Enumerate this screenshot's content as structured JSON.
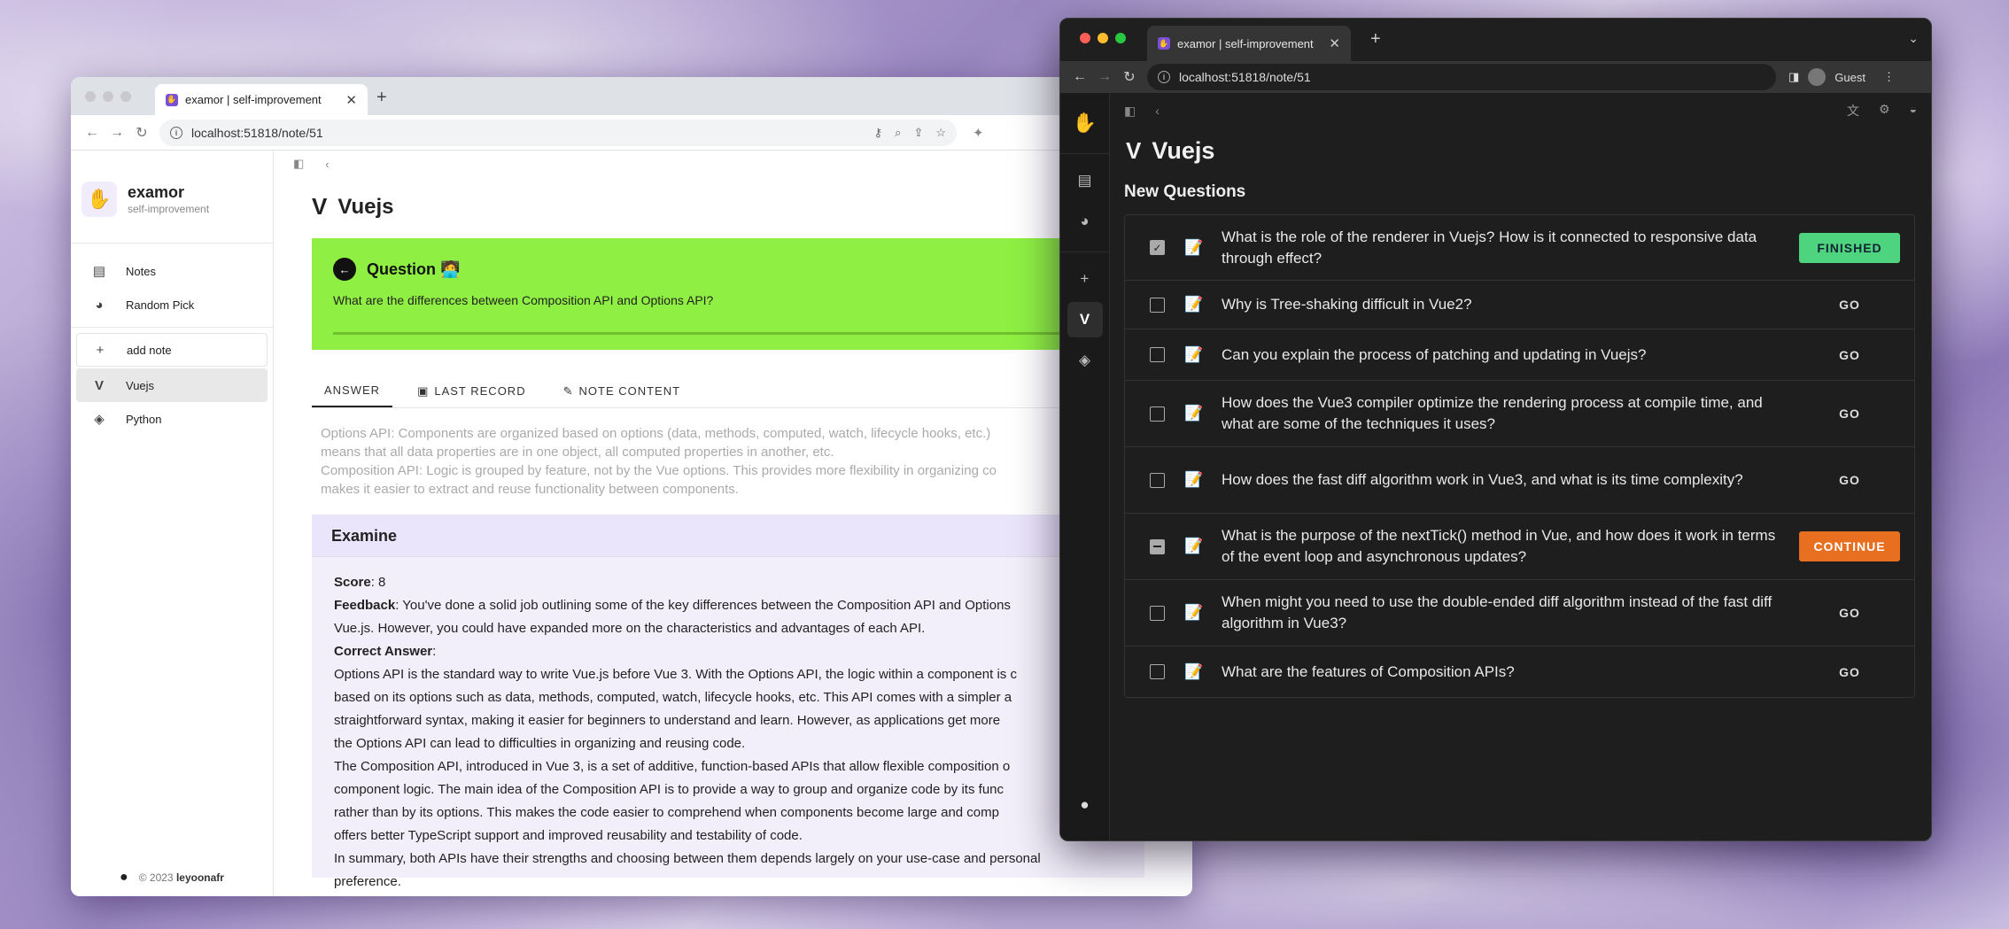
{
  "left": {
    "tab_title": "examor | self-improvement",
    "url": "localhost:51818/note/51",
    "brand": {
      "name": "examor",
      "subtitle": "self-improvement"
    },
    "nav": [
      {
        "label": "Notes",
        "icon": "notes-icon"
      },
      {
        "label": "Random Pick",
        "icon": "brain-icon"
      }
    ],
    "add_note": "add note",
    "notes": [
      {
        "label": "Vuejs",
        "icon": "vue-icon"
      },
      {
        "label": "Python",
        "icon": "python-icon"
      }
    ],
    "footer": {
      "copy": "© 2023",
      "author": "leyoonafr"
    },
    "page_title": "Vuejs",
    "question": {
      "heading": "Question",
      "emoji": "🧑‍💻",
      "text": "What are the differences between Composition API and Options API?"
    },
    "tabs": [
      "ANSWER",
      "LAST RECORD",
      "NOTE CONTENT"
    ],
    "answer_lines": [
      "Options API: Components are organized based on options (data, methods, computed, watch, lifecycle hooks, etc.)",
      "means that all data properties are in one object, all computed properties in another, etc.",
      "Composition API: Logic is grouped by feature, not by the Vue options. This provides more flexibility in organizing co",
      "makes it easier to extract and reuse functionality between components."
    ],
    "examine": {
      "heading": "Examine",
      "score_label": "Score",
      "score": "8",
      "feedback_label": "Feedback",
      "feedback": "You've done a solid job outlining some of the key differences between the Composition API and Options",
      "feedback2": "Vue.js. However, you could have expanded more on the characteristics and advantages of each API.",
      "correct_label": "Correct Answer",
      "lines": [
        "Options API is the standard way to write Vue.js before Vue 3. With the Options API, the logic within a component is c",
        "based on its options such as data, methods, computed, watch, lifecycle hooks, etc. This API comes with a simpler a",
        "straightforward syntax, making it easier for beginners to understand and learn. However, as applications get more",
        "the Options API can lead to difficulties in organizing and reusing code.",
        "The Composition API, introduced in Vue 3, is a set of additive, function-based APIs that allow flexible composition o",
        "component logic. The main idea of the Composition API is to provide a way to group and organize code by its func",
        "rather than by its options. This makes the code easier to comprehend when components become large and comp",
        "offers better TypeScript support and improved reusability and testability of code.",
        "In summary, both APIs have their strengths and choosing between them depends largely on your use-case and personal",
        "preference."
      ]
    }
  },
  "right": {
    "tab_title": "examor | self-improvement",
    "url": "localhost:51818/note/51",
    "profile": "Guest",
    "page_title": "Vuejs",
    "section": "New Questions",
    "questions": [
      {
        "text": "What is the role of the renderer in Vuejs? How is it connected to responsive data through effect?",
        "action": "FINISHED",
        "state": "checked"
      },
      {
        "text": "Why is Tree-shaking difficult in Vue2?",
        "action": "GO",
        "state": "empty"
      },
      {
        "text": "Can you explain the process of patching and updating in Vuejs?",
        "action": "GO",
        "state": "empty"
      },
      {
        "text": "How does the Vue3 compiler optimize the rendering process at compile time, and what are some of the techniques it uses?",
        "action": "GO",
        "state": "empty"
      },
      {
        "text": "How does the fast diff algorithm work in Vue3, and what is its time complexity?",
        "action": "GO",
        "state": "empty"
      },
      {
        "text": "What is the purpose of the nextTick() method in Vue, and how does it work in terms of the event loop and asynchronous updates?",
        "action": "CONTINUE",
        "state": "indeterminate"
      },
      {
        "text": "When might you need to use the double-ended diff algorithm instead of the fast diff algorithm in Vue3?",
        "action": "GO",
        "state": "empty"
      },
      {
        "text": "What are the features of Composition APIs?",
        "action": "GO",
        "state": "empty"
      }
    ]
  },
  "colors": {
    "question_card": "#8ff043",
    "finished": "#4ed37e",
    "continue": "#e86f1f"
  }
}
